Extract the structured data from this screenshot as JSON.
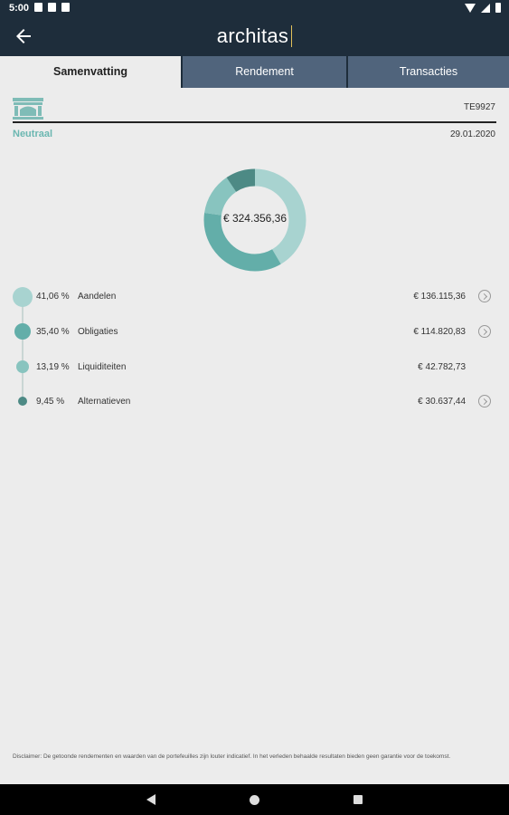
{
  "status_bar": {
    "time": "5:00"
  },
  "app_bar": {
    "logo_text": "architas"
  },
  "tabs": [
    {
      "label": "Samenvatting",
      "active": true
    },
    {
      "label": "Rendement",
      "active": false
    },
    {
      "label": "Transacties",
      "active": false
    }
  ],
  "portfolio": {
    "code": "TE9927",
    "profile": "Neutraal",
    "date": "29.01.2020",
    "total": "€ 324.356,36"
  },
  "allocation": [
    {
      "percent": "41,06 %",
      "category": "Aandelen",
      "amount": "€ 136.115,36",
      "value": 41.06,
      "color": "#a8d3d0",
      "has_detail": true
    },
    {
      "percent": "35,40 %",
      "category": "Obligaties",
      "amount": "€ 114.820,83",
      "value": 35.4,
      "color": "#63aea9",
      "has_detail": true
    },
    {
      "percent": "13,19 %",
      "category": "Liquiditeiten",
      "amount": "€ 42.782,73",
      "value": 13.19,
      "color": "#88c4bf",
      "has_detail": false
    },
    {
      "percent": "9,45 %",
      "category": "Alternatieven",
      "amount": "€ 30.637,44",
      "value": 9.45,
      "color": "#4d8a85",
      "has_detail": true
    }
  ],
  "disclaimer": "Disclaimer: De getoonde rendementen en waarden van de portefeuilles zijn louter indicatief. In het verleden behaalde resultaten bieden geen garantie voor de toekomst.",
  "icons": {
    "back": "arrow-left-icon",
    "bank": "bank-building-icon",
    "chevron": "chevron-right-circle-icon"
  }
}
